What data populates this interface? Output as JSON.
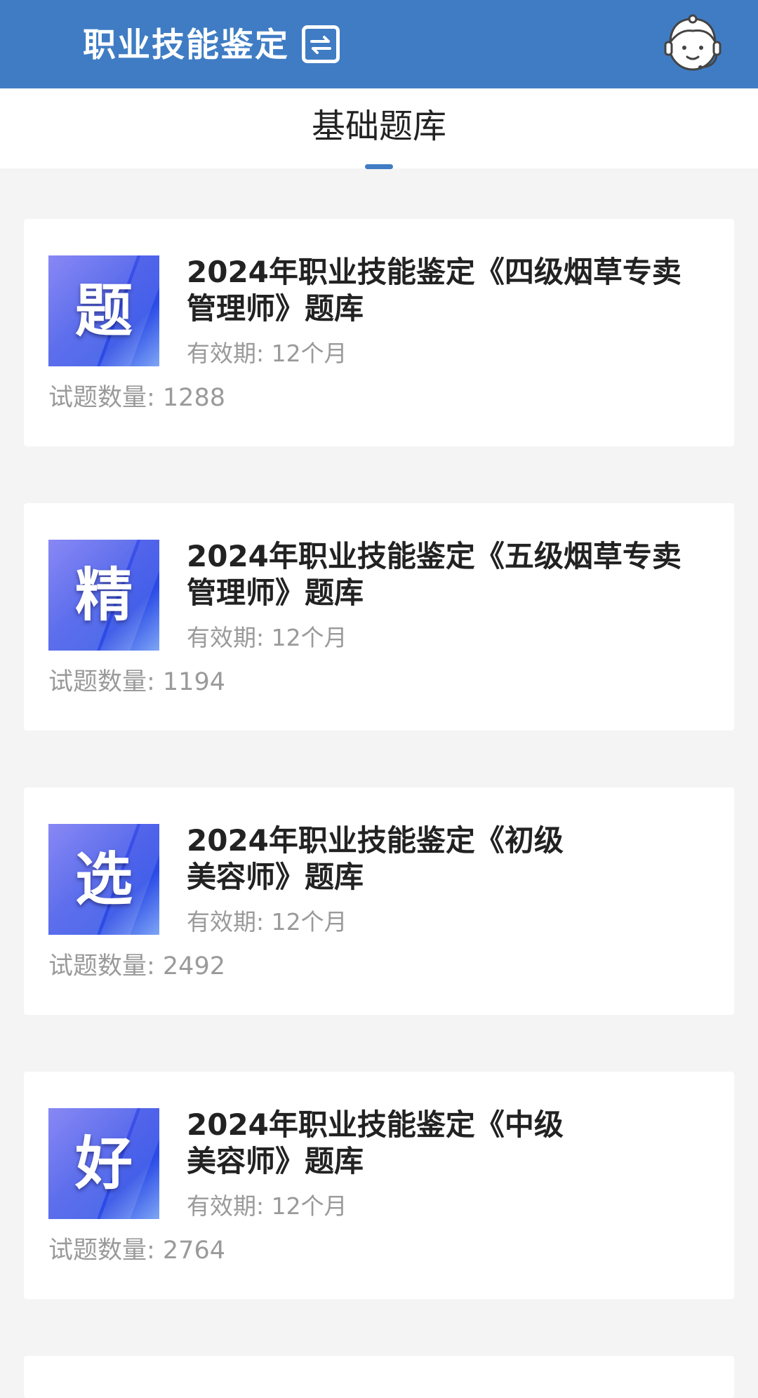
{
  "header": {
    "title": "职业技能鉴定",
    "switch_icon": "switch-icon",
    "support_icon": "customer-service-icon"
  },
  "tabs": [
    {
      "label": "基础题库",
      "active": true
    }
  ],
  "colors": {
    "brand": "#3f7cc4",
    "thumb_blue": "#2b4be6"
  },
  "cards": [
    {
      "thumb_char": "题",
      "title": "2024年职业技能鉴定《四级烟草专卖管理师》题库",
      "validity": "有效期: 12个月",
      "count": "试题数量: 1288"
    },
    {
      "thumb_char": "精",
      "title": "2024年职业技能鉴定《五级烟草专卖管理师》题库",
      "validity": "有效期: 12个月",
      "count": "试题数量: 1194"
    },
    {
      "thumb_char": "选",
      "title": "2024年职业技能鉴定《初级美容师》题库",
      "validity": "有效期: 12个月",
      "count": "试题数量: 2492"
    },
    {
      "thumb_char": "好",
      "title": "2024年职业技能鉴定《中级美容师》题库",
      "validity": "有效期: 12个月",
      "count": "试题数量: 2764"
    }
  ]
}
